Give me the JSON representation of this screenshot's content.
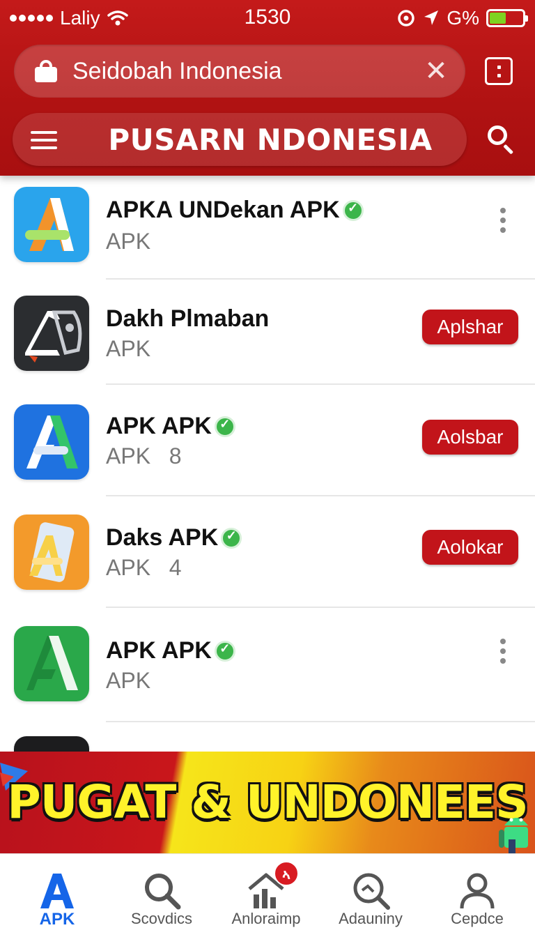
{
  "status_bar": {
    "carrier": "Laliy",
    "time": "1530",
    "network": "G%",
    "battery_level": 0.5,
    "battery_color": "#7ed321"
  },
  "browser": {
    "url": "Seidobah Indonesia",
    "lock_icon": "lock-icon",
    "clear_icon": "close-icon",
    "tabs_icon": "tabs-icon"
  },
  "header": {
    "title": "Pusarn Ndonesia",
    "menu_icon": "menu-icon",
    "search_icon": "search-icon",
    "color": "#b51414"
  },
  "apps": [
    {
      "title": "APKA UNDekan APK",
      "subtitle": "APK",
      "verified": true,
      "action": "menu",
      "icon": "apk-a-icon"
    },
    {
      "title": "Dakh Plmaban",
      "subtitle": "APK",
      "verified": false,
      "action": "Aplshar",
      "icon": "dark-a-icon"
    },
    {
      "title": "APK  APK",
      "subtitle": "APK   8",
      "verified": true,
      "action": "Aolsbar",
      "icon": "blue-a-icon"
    },
    {
      "title": "Daks APK",
      "subtitle": "APK   4",
      "verified": true,
      "action": "Aolokar",
      "icon": "orange-a-icon"
    },
    {
      "title": "APK  APK",
      "subtitle": "APK",
      "verified": true,
      "action": "menu",
      "icon": "green-a-icon"
    }
  ],
  "banner": {
    "text": "PUGAT & UNDONEES"
  },
  "bottom_nav": {
    "items": [
      {
        "label": "APK",
        "icon": "apk-logo-icon",
        "active": true
      },
      {
        "label": "Scovdics",
        "icon": "search-icon",
        "active": false
      },
      {
        "label": "Anloraimp",
        "icon": "home-chart-icon",
        "active": false,
        "badge": "ኣ"
      },
      {
        "label": "Adauniny",
        "icon": "magnifier-chart-icon",
        "active": false
      },
      {
        "label": "Cepdce",
        "icon": "person-icon",
        "active": false
      }
    ]
  },
  "colors": {
    "accent": "#c2141a",
    "active_nav": "#1565e8",
    "verified": "#3cb54a"
  }
}
